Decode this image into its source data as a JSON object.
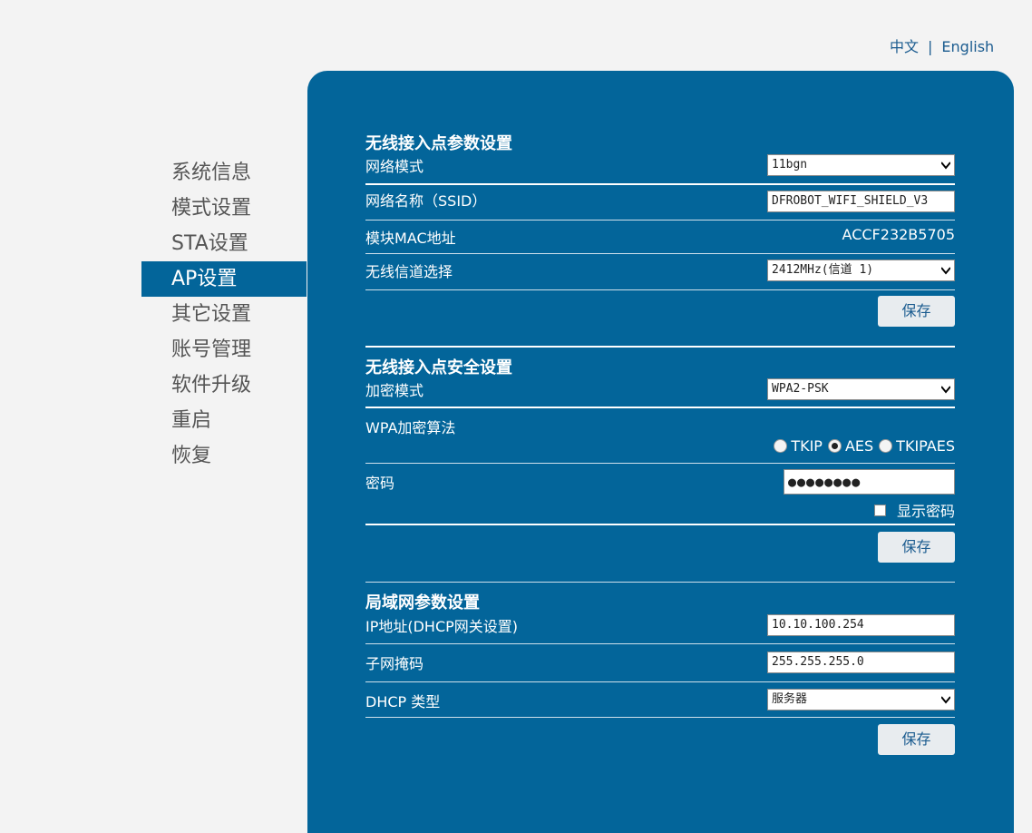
{
  "language": {
    "zh": "中文",
    "separator": "|",
    "en": "English"
  },
  "sidebar": {
    "items": [
      {
        "label": "系统信息"
      },
      {
        "label": "模式设置"
      },
      {
        "label": "STA设置"
      },
      {
        "label": "AP设置",
        "active": true
      },
      {
        "label": "其它设置"
      },
      {
        "label": "账号管理"
      },
      {
        "label": "软件升级"
      },
      {
        "label": "重启"
      },
      {
        "label": "恢复"
      }
    ]
  },
  "ap_params": {
    "title": "无线接入点参数设置",
    "network_mode": {
      "label": "网络模式",
      "value": "11bgn"
    },
    "ssid": {
      "label": "网络名称（SSID）",
      "value": "DFROBOT_WIFI_SHIELD_V3"
    },
    "mac": {
      "label": "模块MAC地址",
      "value": "ACCF232B5705"
    },
    "channel": {
      "label": "无线信道选择",
      "value": "2412MHz(信道 1)"
    },
    "save_label": "保存"
  },
  "ap_security": {
    "title": "无线接入点安全设置",
    "encryption": {
      "label": "加密模式",
      "value": "WPA2-PSK"
    },
    "algorithm": {
      "label": "WPA加密算法",
      "options": [
        {
          "label": "TKIP",
          "checked": false
        },
        {
          "label": "AES",
          "checked": true
        },
        {
          "label": "TKIPAES",
          "checked": false
        }
      ]
    },
    "password": {
      "label": "密码",
      "value": "●●●●●●●●",
      "show_label": "显示密码",
      "show_checked": false
    },
    "save_label": "保存"
  },
  "lan": {
    "title": "局域网参数设置",
    "ip": {
      "label": "IP地址(DHCP网关设置)",
      "value": "10.10.100.254"
    },
    "mask": {
      "label": "子网掩码",
      "value": "255.255.255.0"
    },
    "dhcp": {
      "label": "DHCP 类型",
      "value": "服务器"
    },
    "save_label": "保存"
  },
  "colors": {
    "panel": "#03659a",
    "background": "#f3f3f3",
    "link": "#1a5b8f"
  }
}
